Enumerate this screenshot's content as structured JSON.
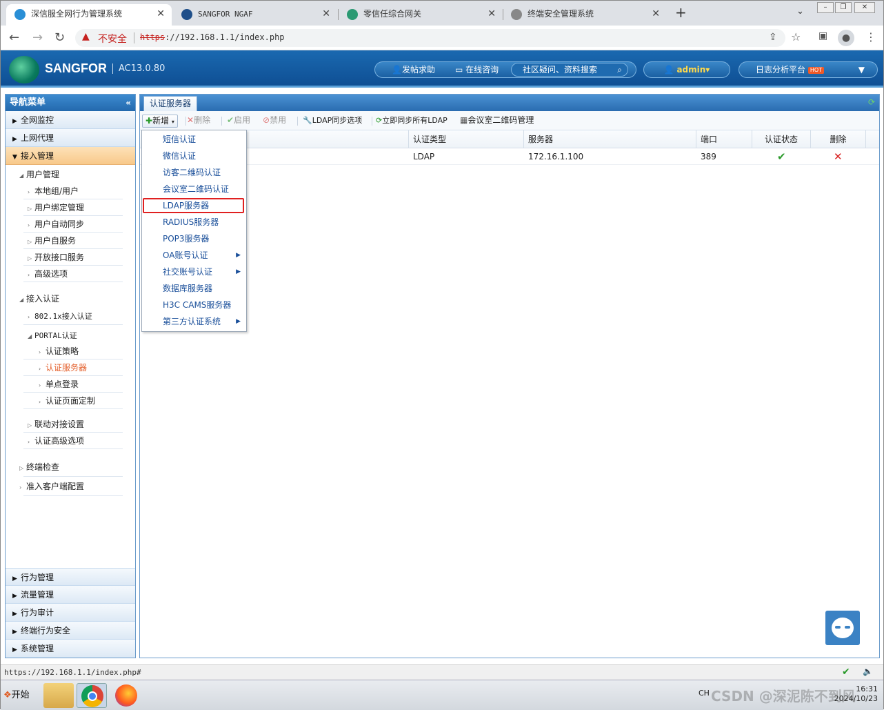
{
  "browser": {
    "tabs": [
      {
        "title": "深信服全网行为管理系统",
        "active": true
      },
      {
        "title": "SANGFOR NGAF",
        "active": false
      },
      {
        "title": "零信任综合网关",
        "active": false
      },
      {
        "title": "终端安全管理系统",
        "active": false
      }
    ],
    "new_tab": "+",
    "insecure": "不安全",
    "url_scheme": "https",
    "url_rest": "://192.168.1.1/index.php"
  },
  "app": {
    "brand": "SANGFOR",
    "version": "AC13.0.80",
    "help": "发帖求助",
    "consult": "在线咨询",
    "community": "社区疑问、资料搜索",
    "user": "admin",
    "log_platform": "日志分析平台",
    "hot": "HOT"
  },
  "sidebar": {
    "title": "导航菜单",
    "top_sections": [
      "全网监控",
      "上网代理",
      "接入管理"
    ],
    "groups": [
      {
        "label": "用户管理",
        "items": [
          "本地组/用户",
          "用户绑定管理",
          "用户自动同步",
          "用户自服务",
          "开放接口服务",
          "高级选项"
        ]
      },
      {
        "label": "接入认证",
        "items": [
          "802.1x接入认证"
        ]
      }
    ],
    "portal": {
      "label": "PORTAL认证",
      "items": [
        "认证策略",
        "认证服务器",
        "单点登录",
        "认证页面定制"
      ]
    },
    "extra_items": [
      "联动对接设置",
      "认证高级选项"
    ],
    "extra_groups": [
      "终端检查",
      "准入客户端配置"
    ],
    "bottom_sections": [
      "行为管理",
      "流量管理",
      "行为审计",
      "终端行为安全",
      "系统管理"
    ]
  },
  "main": {
    "tab": "认证服务器",
    "toolbar": {
      "add": "新增",
      "delete": "删除",
      "enable": "启用",
      "disable": "禁用",
      "ldap_sync": "LDAP同步选项",
      "sync_all": "立即同步所有LDAP",
      "qr": "会议室二维码管理"
    },
    "columns": [
      "认证类型",
      "服务器",
      "端口",
      "认证状态",
      "删除"
    ],
    "rows": [
      {
        "type": "LDAP",
        "server": "172.16.1.100",
        "port": "389"
      }
    ]
  },
  "dropdown": {
    "items": [
      {
        "label": "短信认证",
        "sub": false
      },
      {
        "label": "微信认证",
        "sub": false
      },
      {
        "label": "访客二维码认证",
        "sub": false
      },
      {
        "label": "会议室二维码认证",
        "sub": false
      },
      {
        "label": "LDAP服务器",
        "sub": false
      },
      {
        "label": "RADIUS服务器",
        "sub": false
      },
      {
        "label": "POP3服务器",
        "sub": false
      },
      {
        "label": "OA账号认证",
        "sub": true
      },
      {
        "label": "社交账号认证",
        "sub": true
      },
      {
        "label": "数据库服务器",
        "sub": false
      },
      {
        "label": "H3C CAMS服务器",
        "sub": false
      },
      {
        "label": "第三方认证系统",
        "sub": true
      }
    ]
  },
  "status_url": "https://192.168.1.1/index.php#",
  "taskbar": {
    "start": "开始",
    "ime": "CH",
    "time": "16:31",
    "date": "2024/10/23"
  },
  "watermark": "CSDN @深泥陈不到风"
}
